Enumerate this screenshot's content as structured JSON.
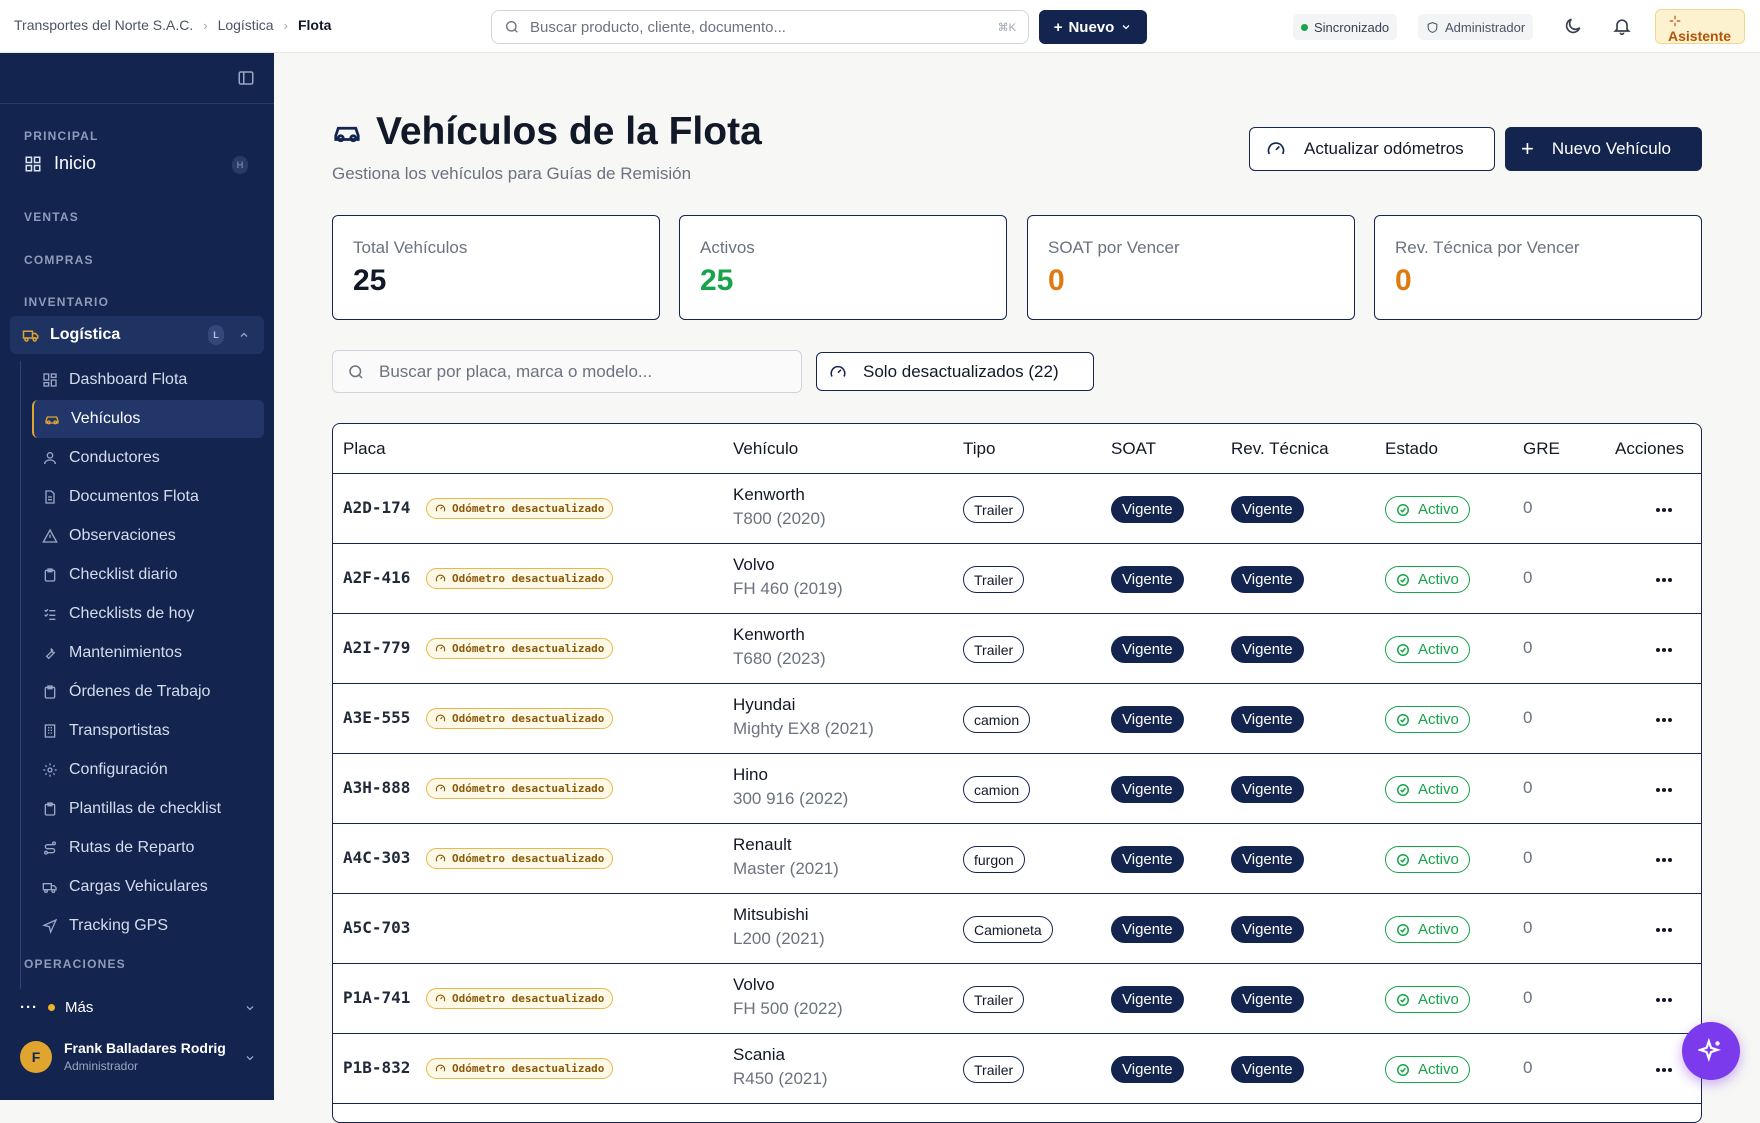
{
  "topbar": {
    "breadcrumb": [
      "Transportes del Norte S.A.C.",
      "Logística",
      "Flota"
    ],
    "search_placeholder": "Buscar producto, cliente, documento...",
    "search_shortcut": "⌘K",
    "new_label": "Nuevo",
    "sync_label": "Sincronizado",
    "role_label": "Administrador",
    "assistant_label": "Asistente"
  },
  "sidebar": {
    "sections": [
      "PRINCIPAL",
      "VENTAS",
      "COMPRAS",
      "INVENTARIO",
      "OPERACIONES"
    ],
    "inicio": {
      "label": "Inicio",
      "key": "H"
    },
    "logistica": {
      "label": "Logística",
      "key": "L"
    },
    "items": [
      {
        "label": "Dashboard Flota",
        "icon": "dashboard-icon"
      },
      {
        "label": "Vehículos",
        "icon": "car-icon"
      },
      {
        "label": "Conductores",
        "icon": "user-icon"
      },
      {
        "label": "Documentos Flota",
        "icon": "document-icon"
      },
      {
        "label": "Observaciones",
        "icon": "warning-icon"
      },
      {
        "label": "Checklist diario",
        "icon": "clipboard-icon"
      },
      {
        "label": "Checklists de hoy",
        "icon": "list-check-icon"
      },
      {
        "label": "Mantenimientos",
        "icon": "wrench-icon"
      },
      {
        "label": "Órdenes de Trabajo",
        "icon": "clipboard-icon"
      },
      {
        "label": "Transportistas",
        "icon": "building-icon"
      },
      {
        "label": "Configuración",
        "icon": "gear-icon"
      },
      {
        "label": "Plantillas de checklist",
        "icon": "clipboard-icon"
      },
      {
        "label": "Rutas de Reparto",
        "icon": "route-icon"
      },
      {
        "label": "Cargas Vehiculares",
        "icon": "truck-icon"
      },
      {
        "label": "Tracking GPS",
        "icon": "navigation-icon"
      }
    ],
    "active_index": 1,
    "more_label": "Más",
    "user": {
      "initial": "F",
      "name": "Frank Balladares Rodriguez",
      "role": "Administrador"
    }
  },
  "page": {
    "title": "Vehículos de la Flota",
    "subtitle": "Gestiona los vehículos para Guías de Remisión",
    "update_odometers_label": "Actualizar odómetros",
    "new_vehicle_label": "Nuevo Vehículo"
  },
  "stats": [
    {
      "label": "Total Vehículos",
      "value": "25",
      "color": "#111827"
    },
    {
      "label": "Activos",
      "value": "25",
      "color": "#16a34a"
    },
    {
      "label": "SOAT por Vencer",
      "value": "0",
      "color": "#e07a10"
    },
    {
      "label": "Rev. Técnica por Vencer",
      "value": "0",
      "color": "#e07a10"
    }
  ],
  "filters": {
    "search_placeholder": "Buscar por placa, marca o modelo...",
    "outdated_label": "Solo desactualizados (22)"
  },
  "table": {
    "columns": [
      "Placa",
      "Vehículo",
      "Tipo",
      "SOAT",
      "Rev. Técnica",
      "Estado",
      "GRE",
      "Acciones"
    ],
    "odometer_badge": "Odómetro desactualizado",
    "rows": [
      {
        "placa": "A2D-174",
        "odo": true,
        "marca": "Kenworth",
        "modelo": "T800 (2020)",
        "tipo": "Trailer",
        "soat": "Vigente",
        "rev": "Vigente",
        "estado": "Activo",
        "gre": "0"
      },
      {
        "placa": "A2F-416",
        "odo": true,
        "marca": "Volvo",
        "modelo": "FH 460 (2019)",
        "tipo": "Trailer",
        "soat": "Vigente",
        "rev": "Vigente",
        "estado": "Activo",
        "gre": "0"
      },
      {
        "placa": "A2I-779",
        "odo": true,
        "marca": "Kenworth",
        "modelo": "T680 (2023)",
        "tipo": "Trailer",
        "soat": "Vigente",
        "rev": "Vigente",
        "estado": "Activo",
        "gre": "0"
      },
      {
        "placa": "A3E-555",
        "odo": true,
        "marca": "Hyundai",
        "modelo": "Mighty EX8 (2021)",
        "tipo": "camion",
        "soat": "Vigente",
        "rev": "Vigente",
        "estado": "Activo",
        "gre": "0"
      },
      {
        "placa": "A3H-888",
        "odo": true,
        "marca": "Hino",
        "modelo": "300 916 (2022)",
        "tipo": "camion",
        "soat": "Vigente",
        "rev": "Vigente",
        "estado": "Activo",
        "gre": "0"
      },
      {
        "placa": "A4C-303",
        "odo": true,
        "marca": "Renault",
        "modelo": "Master (2021)",
        "tipo": "furgon",
        "soat": "Vigente",
        "rev": "Vigente",
        "estado": "Activo",
        "gre": "0"
      },
      {
        "placa": "A5C-703",
        "odo": false,
        "marca": "Mitsubishi",
        "modelo": "L200 (2021)",
        "tipo": "Camioneta",
        "soat": "Vigente",
        "rev": "Vigente",
        "estado": "Activo",
        "gre": "0"
      },
      {
        "placa": "P1A-741",
        "odo": true,
        "marca": "Volvo",
        "modelo": "FH 500 (2022)",
        "tipo": "Trailer",
        "soat": "Vigente",
        "rev": "Vigente",
        "estado": "Activo",
        "gre": "0"
      },
      {
        "placa": "P1B-832",
        "odo": true,
        "marca": "Scania",
        "modelo": "R450 (2021)",
        "tipo": "Trailer",
        "soat": "Vigente",
        "rev": "Vigente",
        "estado": "Activo",
        "gre": "0"
      }
    ]
  },
  "colors": {
    "navy": "#13244f",
    "accent": "#e0a52e",
    "success": "#16a34a",
    "warning": "#e07a10",
    "fab": "#7c3aed"
  }
}
